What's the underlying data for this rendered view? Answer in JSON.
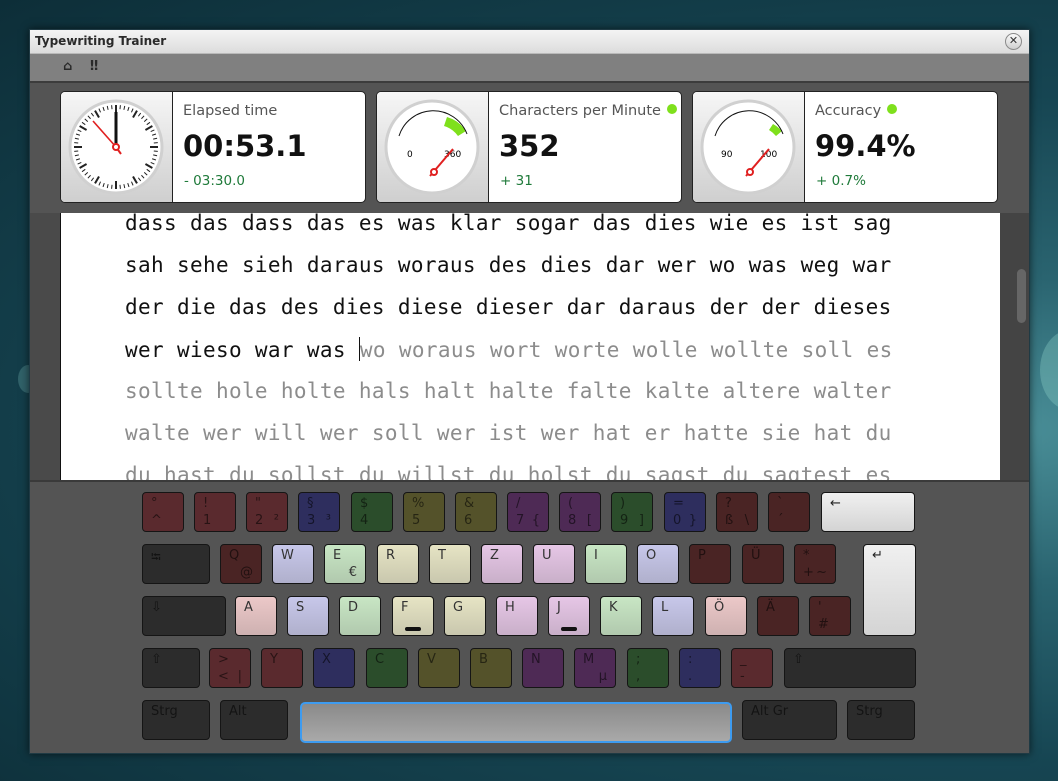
{
  "window": {
    "title": "Typewriting Trainer",
    "close_icon": "close-icon"
  },
  "toolbar": {
    "home_icon": "⌂",
    "pause_icon": "‼"
  },
  "stats": [
    {
      "id": "elapsed",
      "label": "Elapsed time",
      "value": "00:53.1",
      "delta": "- 03:30.0",
      "indicator": false
    },
    {
      "id": "cpm",
      "label": "Characters per Minute",
      "value": "352",
      "delta": "+ 31",
      "indicator": true,
      "gauge": {
        "min_label": "0",
        "target_label": "360",
        "value": 352
      }
    },
    {
      "id": "accuracy",
      "label": "Accuracy",
      "value": "99.4%",
      "delta": "+ 0.7%",
      "indicator": true,
      "gauge": {
        "min_label": "90",
        "target_label": "100",
        "value": 99.4
      }
    }
  ],
  "colors": {
    "indicator": "#7fe01c",
    "delta": "#1f7a3a",
    "space_focus": "#3d9bf0"
  },
  "text": {
    "lines": [
      {
        "typed": "dass das dass das es was klar sogar das dies wie es ist sag",
        "untyped": ""
      },
      {
        "typed": "sah sehe sieh daraus woraus des dies dar wer wo was weg war",
        "untyped": ""
      },
      {
        "typed": "der die das des dies diese dieser dar daraus der der dieses",
        "untyped": ""
      },
      {
        "typed": "wer wieso war was ",
        "untyped": "wo woraus wort worte wolle wollte soll es"
      },
      {
        "typed": "",
        "untyped": "sollte hole holte hals halt halte falte kalte altere walter"
      },
      {
        "typed": "",
        "untyped": "walte wer will wer soll wer ist wer hat er hatte sie hat du"
      },
      {
        "typed": "",
        "untyped": "du hast du sollst du willst du holst du sagst du sagtest es"
      }
    ]
  },
  "keyboard": {
    "rows": [
      [
        {
          "p": "°",
          "s": "^",
          "a": "",
          "color": "#5a2a2e",
          "dim": true
        },
        {
          "p": "!",
          "s": "1",
          "a": "",
          "color": "#5a2a2e",
          "dim": true
        },
        {
          "p": "\"",
          "s": "2",
          "a": "²",
          "color": "#5a2a2e",
          "dim": true
        },
        {
          "p": "§",
          "s": "3",
          "a": "³",
          "color": "#2e2e5e",
          "dim": true
        },
        {
          "p": "$",
          "s": "4",
          "a": "",
          "color": "#2b4d2b",
          "dim": true
        },
        {
          "p": "%",
          "s": "5",
          "a": "",
          "color": "#54522a",
          "dim": true
        },
        {
          "p": "&",
          "s": "6",
          "a": "",
          "color": "#54522a",
          "dim": true
        },
        {
          "p": "/",
          "s": "7",
          "a": "{",
          "color": "#4e2a55",
          "dim": true
        },
        {
          "p": "(",
          "s": "8",
          "a": "[",
          "color": "#4e2a55",
          "dim": true
        },
        {
          "p": ")",
          "s": "9",
          "a": "]",
          "color": "#2b4d2b",
          "dim": true
        },
        {
          "p": "=",
          "s": "0",
          "a": "}",
          "color": "#2e2e5e",
          "dim": true
        },
        {
          "p": "?",
          "s": "ß",
          "a": "\\",
          "color": "#4a2424",
          "dim": true
        },
        {
          "p": "`",
          "s": "´",
          "a": "",
          "color": "#4a2424",
          "dim": true
        },
        {
          "p": "←",
          "s": "",
          "a": "",
          "color": "#e6e6e6",
          "dim": false,
          "name": "backspace"
        }
      ],
      [
        {
          "p": "⭾",
          "s": "",
          "a": "",
          "color": "#2c2c2c",
          "dim": true,
          "name": "tab"
        },
        {
          "p": "Q",
          "s": "",
          "a": "@",
          "color": "#4a2424",
          "dim": true
        },
        {
          "p": "W",
          "s": "",
          "a": "",
          "color": "#c7c7ea",
          "dim": false
        },
        {
          "p": "E",
          "s": "",
          "a": "€",
          "color": "#c8e6c4",
          "dim": false
        },
        {
          "p": "R",
          "s": "",
          "a": "",
          "color": "#e6e4c4",
          "dim": false
        },
        {
          "p": "T",
          "s": "",
          "a": "",
          "color": "#e6e4c4",
          "dim": false
        },
        {
          "p": "Z",
          "s": "",
          "a": "",
          "color": "#e6c6e6",
          "dim": false
        },
        {
          "p": "U",
          "s": "",
          "a": "",
          "color": "#e6c6e6",
          "dim": false
        },
        {
          "p": "I",
          "s": "",
          "a": "",
          "color": "#c8e6c4",
          "dim": false
        },
        {
          "p": "O",
          "s": "",
          "a": "",
          "color": "#c7c7ea",
          "dim": false
        },
        {
          "p": "P",
          "s": "",
          "a": "",
          "color": "#4a2424",
          "dim": true
        },
        {
          "p": "Ü",
          "s": "",
          "a": "",
          "color": "#4a2424",
          "dim": true
        },
        {
          "p": "*",
          "s": "+",
          "a": "~",
          "color": "#4a2424",
          "dim": true
        },
        {
          "p": "↵",
          "s": "",
          "a": "",
          "color": "#e6e6e6",
          "dim": false,
          "name": "enter"
        }
      ],
      [
        {
          "p": "⇩",
          "s": "",
          "a": "",
          "color": "#2c2c2c",
          "dim": true,
          "name": "caps-lock"
        },
        {
          "p": "A",
          "s": "",
          "a": "",
          "color": "#ecc8c8",
          "dim": false
        },
        {
          "p": "S",
          "s": "",
          "a": "",
          "color": "#c7c7ea",
          "dim": false
        },
        {
          "p": "D",
          "s": "",
          "a": "",
          "color": "#c8e6c4",
          "dim": false
        },
        {
          "p": "F",
          "s": "",
          "a": "",
          "color": "#e6e4c4",
          "dim": false,
          "bump": true
        },
        {
          "p": "G",
          "s": "",
          "a": "",
          "color": "#e6e4c4",
          "dim": false
        },
        {
          "p": "H",
          "s": "",
          "a": "",
          "color": "#e6c6e6",
          "dim": false
        },
        {
          "p": "J",
          "s": "",
          "a": "",
          "color": "#e6c6e6",
          "dim": false,
          "bump": true
        },
        {
          "p": "K",
          "s": "",
          "a": "",
          "color": "#c8e6c4",
          "dim": false
        },
        {
          "p": "L",
          "s": "",
          "a": "",
          "color": "#c7c7ea",
          "dim": false
        },
        {
          "p": "Ö",
          "s": "",
          "a": "",
          "color": "#ecc8c8",
          "dim": false
        },
        {
          "p": "Ä",
          "s": "",
          "a": "",
          "color": "#4a2424",
          "dim": true
        },
        {
          "p": "'",
          "s": "#",
          "a": "",
          "color": "#4a2424",
          "dim": true
        }
      ],
      [
        {
          "p": "⇧",
          "s": "",
          "a": "",
          "color": "#2c2c2c",
          "dim": true,
          "name": "left-shift"
        },
        {
          "p": ">",
          "s": "<",
          "a": "|",
          "color": "#5a2a2e",
          "dim": true
        },
        {
          "p": "Y",
          "s": "",
          "a": "",
          "color": "#5a2a2e",
          "dim": true
        },
        {
          "p": "X",
          "s": "",
          "a": "",
          "color": "#2e2e5e",
          "dim": true
        },
        {
          "p": "C",
          "s": "",
          "a": "",
          "color": "#2b4d2b",
          "dim": true
        },
        {
          "p": "V",
          "s": "",
          "a": "",
          "color": "#54522a",
          "dim": true
        },
        {
          "p": "B",
          "s": "",
          "a": "",
          "color": "#54522a",
          "dim": true
        },
        {
          "p": "N",
          "s": "",
          "a": "",
          "color": "#4e2a55",
          "dim": true
        },
        {
          "p": "M",
          "s": "",
          "a": "µ",
          "color": "#4e2a55",
          "dim": true
        },
        {
          "p": ";",
          "s": ",",
          "a": "",
          "color": "#2b4d2b",
          "dim": true
        },
        {
          "p": ":",
          "s": ".",
          "a": "",
          "color": "#2e2e5e",
          "dim": true
        },
        {
          "p": "_",
          "s": "-",
          "a": "",
          "color": "#5a2a2e",
          "dim": true
        },
        {
          "p": "⇧",
          "s": "",
          "a": "",
          "color": "#2c2c2c",
          "dim": true,
          "name": "right-shift"
        }
      ],
      [
        {
          "p": "Strg",
          "s": "",
          "a": "",
          "color": "#2c2c2c",
          "dim": true,
          "name": "left-ctrl"
        },
        {
          "p": "Alt",
          "s": "",
          "a": "",
          "color": "#2c2c2c",
          "dim": true,
          "name": "alt"
        },
        {
          "p": "",
          "s": "",
          "a": "",
          "color": "#a0a0a0",
          "dim": false,
          "name": "space"
        },
        {
          "p": "Alt Gr",
          "s": "",
          "a": "",
          "color": "#2c2c2c",
          "dim": true,
          "name": "alt-gr"
        },
        {
          "p": "Strg",
          "s": "",
          "a": "",
          "color": "#2c2c2c",
          "dim": true,
          "name": "right-ctrl"
        }
      ]
    ]
  }
}
